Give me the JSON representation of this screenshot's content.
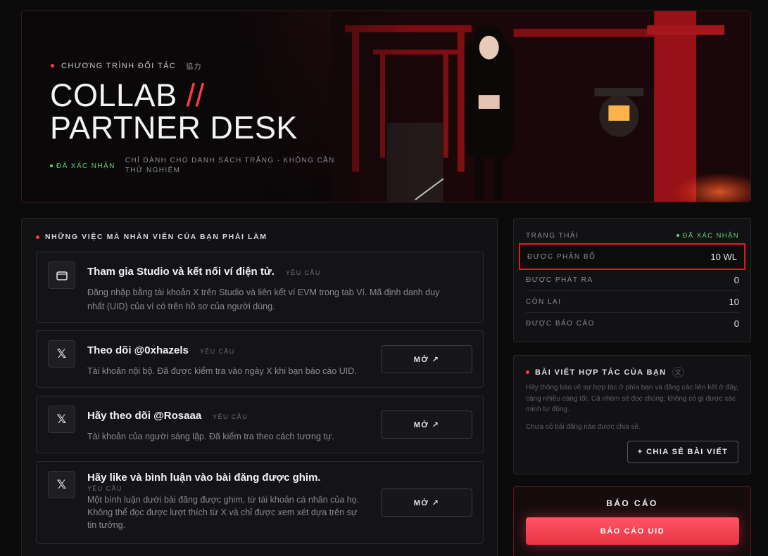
{
  "hero": {
    "eyebrow": "CHƯƠNG TRÌNH ĐỐI TÁC",
    "eyebrow_kanji": "協力",
    "title_line1": "COLLAB",
    "title_slash": "//",
    "title_line2": "PARTNER DESK",
    "verified": "ĐÃ XÁC NHẬN",
    "note": "CHỈ DÀNH CHO DANH SÁCH TRẮNG · KHÔNG CẦN THỬ NGHIỆM"
  },
  "tasks": {
    "header": "NHỮNG VIỆC MÀ NHÂN VIÊN CỦA BẠN PHẢI LÀM",
    "items": [
      {
        "icon": "wallet-icon",
        "title": "Tham gia Studio và kết nối ví điện tử.",
        "required": "YÊU CẦU",
        "desc_line1": "Đăng nhập bằng tài khoản X trên Studio và liên kết ví EVM trong tab Ví. Mã định danh duy",
        "desc_line2": "nhất (UID) của ví có trên hồ sơ của người dùng."
      },
      {
        "icon": "x-logo-icon",
        "title": "Theo dõi @0xhazels",
        "required": "YÊU CẦU",
        "desc_line1": "Tài khoản nội bộ. Đã được kiểm tra vào ngày X khi bạn báo cáo UID.",
        "button": "MỞ ↗"
      },
      {
        "icon": "x-logo-icon",
        "title": "Hãy theo dõi @Rosaaa",
        "required": "YÊU CẦU",
        "desc_line1": "Tài khoản của người sáng lập. Đã kiểm tra theo cách tương tự.",
        "button": "MỞ ↗"
      },
      {
        "icon": "x-logo-icon",
        "title": "Hãy like và bình luận vào bài đăng được ghim.",
        "required": "YÊU CẦU",
        "desc_line1": "Một bình luận dưới bài đăng được ghim, từ tài khoản cá nhân của họ.",
        "desc_line2": "Không thể đọc được lượt thích từ X và chỉ được xem xét dựa trên sự",
        "desc_line3": "tin tưởng.",
        "button": "MỞ ↗"
      }
    ]
  },
  "status": {
    "rows": [
      {
        "label": "TRẠNG THÁI",
        "value": "ĐÃ XÁC NHẬN"
      },
      {
        "label": "ĐƯỢC PHÂN BỔ",
        "value": "10 WL"
      },
      {
        "label": "ĐƯỢC PHÁT RA",
        "value": "0"
      },
      {
        "label": "CÒN LẠI",
        "value": "10"
      },
      {
        "label": "ĐƯỢC BÁO CÁO",
        "value": "0"
      }
    ]
  },
  "posts": {
    "header": "BÀI VIẾT HỢP TÁC CỦA BẠN",
    "kanji": "文",
    "desc": "Hãy thông báo về sự hợp tác ở phía bạn và đăng các liên kết ở đây, càng nhiều càng tốt. Cả nhóm sẽ đọc chúng; không có gì được xác minh tự động.",
    "empty": "Chưa có bài đăng nào được chia sẻ.",
    "share_button": "+ CHIA SẺ BÀI VIẾT"
  },
  "report": {
    "title": "BÁO CÁO",
    "button": "BÁO CÁO UID"
  },
  "colors": {
    "accent": "#ff3b4a",
    "verified": "#5fd47a",
    "highlight": "#e0181c"
  }
}
